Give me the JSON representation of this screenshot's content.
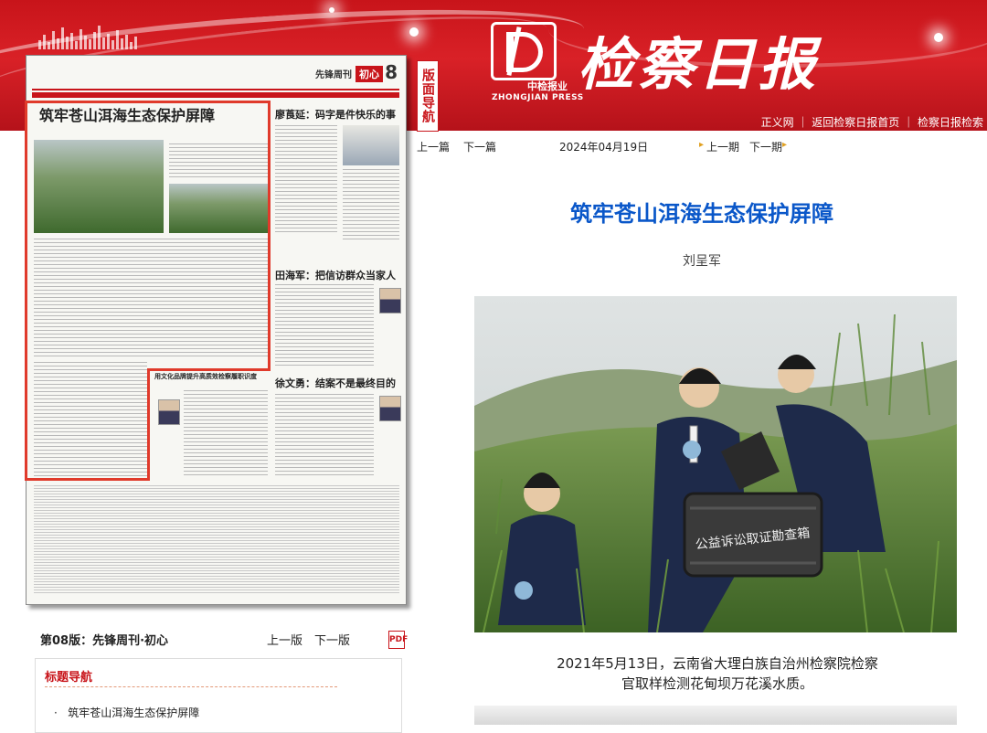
{
  "banner": {
    "paper_title": "检察日报",
    "logo_small_text": "中检报业",
    "logo_press_text": "ZHONGJIAN PRESS",
    "nav_label": "版面导航",
    "links": [
      "正义网",
      "返回检察日报首页",
      "检察日报检索"
    ]
  },
  "thumbnail": {
    "section": "先锋周刊",
    "column": "初心",
    "page_num": "8",
    "headline": "筑牢苍山洱海生态保护屏障",
    "side_headlines": [
      "廖莨延：码字是件快乐的事",
      "田海军：把信访群众当家人",
      "徐文勇：结案不是最终目的",
      "用文化品牌提升高质效检察履职识度"
    ]
  },
  "page_nav": {
    "label": "第08版：先锋周刊·初心",
    "prev": "上一版",
    "next": "下一版",
    "pdf_icon": "pdf-icon"
  },
  "title_nav": {
    "heading": "标题导航",
    "items": [
      "筑牢苍山洱海生态保护屏障"
    ]
  },
  "article_nav": {
    "prev_article": "上一篇",
    "next_article": "下一篇",
    "date": "2024年04月19日",
    "prev_issue": "上一期",
    "next_issue": "下一期"
  },
  "article": {
    "title": "筑牢苍山洱海生态保护屏障",
    "author": "刘呈军",
    "photo_case_text": "公益诉讼取证勘查箱",
    "caption_line1": "2021年5月13日，云南省大理白族自治州检察院检察",
    "caption_line2": "官取样检测花甸坝万花溪水质。"
  },
  "colors": {
    "brand_red": "#c8141a",
    "title_blue": "#0a57c9",
    "highlight_red": "#e03a2b"
  }
}
